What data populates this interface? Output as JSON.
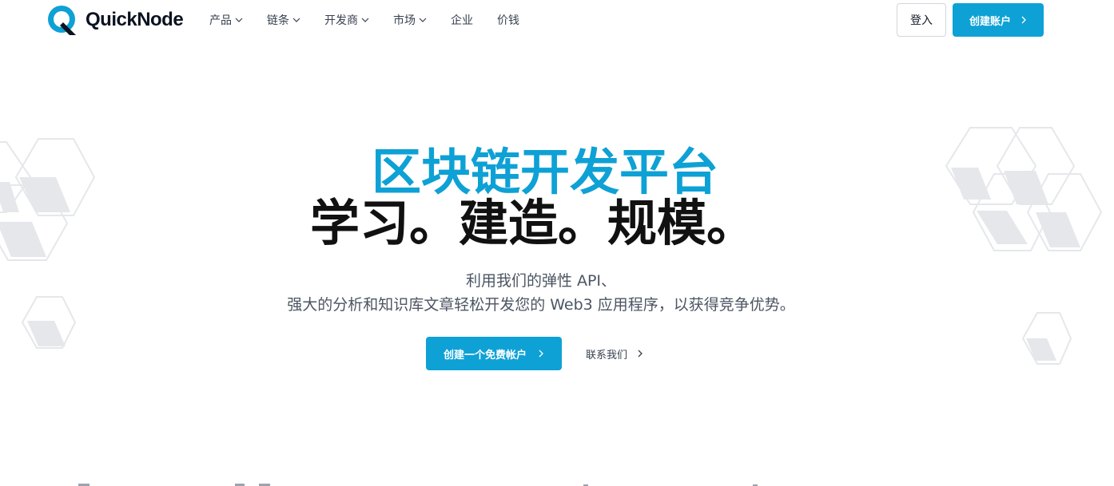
{
  "header": {
    "brand": "QuickNode",
    "nav": [
      {
        "label": "产品",
        "dropdown": true
      },
      {
        "label": "链条",
        "dropdown": true
      },
      {
        "label": "开发商",
        "dropdown": true
      },
      {
        "label": "市场",
        "dropdown": true
      },
      {
        "label": "企业",
        "dropdown": false
      },
      {
        "label": "价钱",
        "dropdown": false
      }
    ],
    "login_label": "登入",
    "signup_label": "创建账户"
  },
  "hero": {
    "title_line1": "区块链开发平台",
    "title_line2": "学习。建造。规模。",
    "subtitle_line1": "利用我们的弹性 API、",
    "subtitle_line2": "强大的分析和知识库文章轻松开发您的 Web3 应用程序，以获得竞争优势。",
    "cta_primary": "创建一个免费帐户",
    "cta_secondary": "联系我们"
  },
  "colors": {
    "accent": "#0ea1d5",
    "heading_dark": "#111111",
    "body_text": "#4b5563",
    "hex_fill": "#e5e7eb",
    "hex_stroke": "#e5e7eb"
  },
  "icons": {
    "logo": "quicknode-logo-icon",
    "dropdown": "chevron-down-icon",
    "arrow": "chevron-right-icon"
  }
}
